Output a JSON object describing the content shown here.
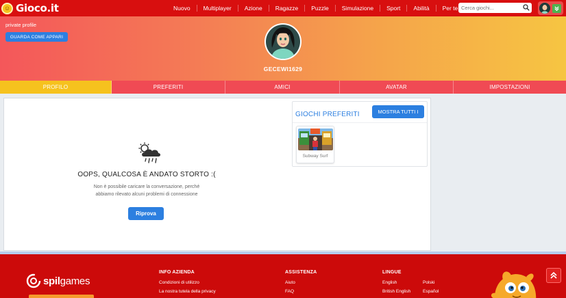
{
  "brand": {
    "name": "Gioco.it"
  },
  "nav": {
    "items": [
      "Nuovo",
      "Multiplayer",
      "Azione",
      "Ragazze",
      "Puzzle",
      "Simulazione",
      "Sport",
      "Abilità",
      "Per te"
    ]
  },
  "search": {
    "placeholder": "Cerca giochi..."
  },
  "profile": {
    "private_label": "private profile",
    "view_button": "GUARDA COME APPARI",
    "username": "GECEWI1629"
  },
  "tabs": [
    {
      "label": "PROFILO",
      "active": true
    },
    {
      "label": "PREFERITI",
      "active": false
    },
    {
      "label": "AMICI",
      "active": false
    },
    {
      "label": "AVATAR",
      "active": false
    },
    {
      "label": "IMPOSTAZIONI",
      "active": false
    }
  ],
  "error": {
    "icon": "cloud-rain-sun-icon",
    "title": "OOPS, QUALCOSA È ANDATO STORTO :(",
    "message_line1": "Non è possibile caricare la conversazione, perché",
    "message_line2": "abbiamo rilevato alcuni problemi di connessione",
    "retry_button": "Riprova"
  },
  "favorites": {
    "title": "GIOCHI PREFERITI",
    "show_all_button": "MOSTRA TUTTI I",
    "games": [
      {
        "name": "Subway Surf"
      }
    ]
  },
  "footer": {
    "company_logo": "spilgames",
    "columns": [
      {
        "heading": "INFO AZIENDA",
        "links": [
          "Condizioni di utilizzo",
          "La nostra tutela della privacy"
        ]
      },
      {
        "heading": "ASSISTENZA",
        "links": [
          "Aiuto",
          "FAQ"
        ]
      },
      {
        "heading": "LINGUE",
        "links": [
          "English",
          "Polski",
          "British English",
          "Español"
        ]
      }
    ]
  },
  "colors": {
    "nav_red": "#d80f0f",
    "tab_active": "#f6c21e",
    "tab_bg": "#f04a54",
    "primary_blue": "#2c7fe0",
    "footer_red": "#cc0a0a"
  }
}
